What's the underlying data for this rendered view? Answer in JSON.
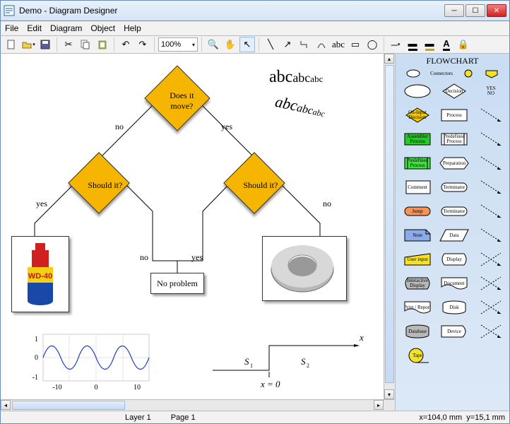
{
  "window": {
    "title": "Demo - Diagram Designer"
  },
  "menu": {
    "file": "File",
    "edit": "Edit",
    "diagram": "Diagram",
    "object": "Object",
    "help": "Help"
  },
  "toolbar": {
    "zoom": "100%"
  },
  "flowchart": {
    "q1": "Does it\nmove?",
    "q2": "Should it?",
    "q3": "Should it?",
    "noproblem": "No problem",
    "no": "no",
    "yes": "yes"
  },
  "textSamples": {
    "big": "abc",
    "med": "abc",
    "sm": "abc"
  },
  "chart_data": {
    "type": "line",
    "x": [
      -10,
      10
    ],
    "title": "",
    "xlabel": "",
    "ylabel": "",
    "ylim": [
      -1,
      1
    ],
    "series": [
      {
        "name": "sin",
        "desc": "sine wave, ~3 periods over [-10,10]"
      }
    ],
    "annotations": {
      "S1": "S₁",
      "S2": "S₂",
      "x": "x",
      "xeq0": "x = 0"
    }
  },
  "palette": {
    "title": "FLOWCHART",
    "connectors": "Connectors",
    "items": [
      {
        "label": "",
        "kind": "ellipse"
      },
      {
        "label": "Decision",
        "kind": "diamond"
      },
      {
        "label": "YES\nNO",
        "kind": "yesno"
      },
      {
        "label": "On-Input\nDecision",
        "kind": "diamond",
        "fill": "#f6c800"
      },
      {
        "label": "Process",
        "kind": "rect"
      },
      {
        "label": "",
        "kind": "arrow"
      },
      {
        "label": "Assembler\nProcess",
        "kind": "rect",
        "fill": "#28c828"
      },
      {
        "label": "Predefined\nProcess",
        "kind": "predef"
      },
      {
        "label": "",
        "kind": "arrow"
      },
      {
        "label": "Predefined\nProcess",
        "kind": "predef",
        "fill": "#40e040"
      },
      {
        "label": "Preparation",
        "kind": "hex"
      },
      {
        "label": "",
        "kind": "arrow"
      },
      {
        "label": "Comment",
        "kind": "bracket"
      },
      {
        "label": "Terminator",
        "kind": "term"
      },
      {
        "label": "",
        "kind": "arrow"
      },
      {
        "label": "Jump",
        "kind": "term",
        "fill": "#f59256"
      },
      {
        "label": "Terminator",
        "kind": "term"
      },
      {
        "label": "",
        "kind": "arrow"
      },
      {
        "label": "Note",
        "kind": "note",
        "fill": "#8ca9e8"
      },
      {
        "label": "Data",
        "kind": "para"
      },
      {
        "label": "",
        "kind": "arrow"
      },
      {
        "label": "User input",
        "kind": "input",
        "fill": "#f6e028"
      },
      {
        "label": "Display",
        "kind": "display"
      },
      {
        "label": "",
        "kind": "arrow2"
      },
      {
        "label": "Interactive\nDisplay",
        "kind": "display",
        "fill": "#b8b8b8"
      },
      {
        "label": "Document",
        "kind": "doc"
      },
      {
        "label": "",
        "kind": "arrow2"
      },
      {
        "label": "Print / Report",
        "kind": "doc"
      },
      {
        "label": "Disk",
        "kind": "cyl"
      },
      {
        "label": "",
        "kind": "arrow2"
      },
      {
        "label": "Database",
        "kind": "cyl",
        "fill": "#b8b8b8"
      },
      {
        "label": "Device",
        "kind": "dev"
      },
      {
        "label": "",
        "kind": "arrow2"
      },
      {
        "label": "Tape",
        "kind": "tape",
        "fill": "#f6e028"
      }
    ]
  },
  "status": {
    "layer": "Layer 1",
    "page": "Page 1",
    "x": "x=104,0 mm",
    "y": "y=15,1 mm"
  }
}
